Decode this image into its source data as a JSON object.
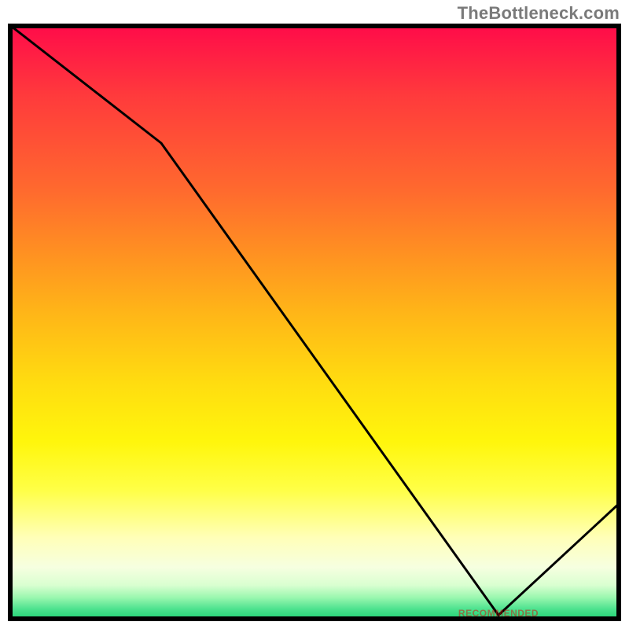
{
  "watermark": "TheBottleneck.com",
  "bottom_label": "RECOMMENDED",
  "chart_data": {
    "type": "line",
    "title": "",
    "xlabel": "",
    "ylabel": "",
    "x": [
      0,
      25,
      80,
      100
    ],
    "values": [
      100,
      80,
      1,
      20
    ],
    "ylim": [
      0,
      100
    ],
    "xlim": [
      0,
      100
    ],
    "bottom_label_x_percent": 80,
    "gradient_stops": [
      {
        "pos": 0,
        "color": "#ff0a4a"
      },
      {
        "pos": 12,
        "color": "#ff3a3c"
      },
      {
        "pos": 28,
        "color": "#ff6a2e"
      },
      {
        "pos": 38,
        "color": "#ff8f22"
      },
      {
        "pos": 48,
        "color": "#ffb418"
      },
      {
        "pos": 60,
        "color": "#ffdc10"
      },
      {
        "pos": 70,
        "color": "#fff60c"
      },
      {
        "pos": 78,
        "color": "#ffff46"
      },
      {
        "pos": 86,
        "color": "#ffffb8"
      },
      {
        "pos": 91,
        "color": "#f6ffe0"
      },
      {
        "pos": 94,
        "color": "#d9ffd0"
      },
      {
        "pos": 96,
        "color": "#9cf7b0"
      },
      {
        "pos": 98,
        "color": "#4ce28e"
      },
      {
        "pos": 100,
        "color": "#18cf6e"
      }
    ]
  }
}
